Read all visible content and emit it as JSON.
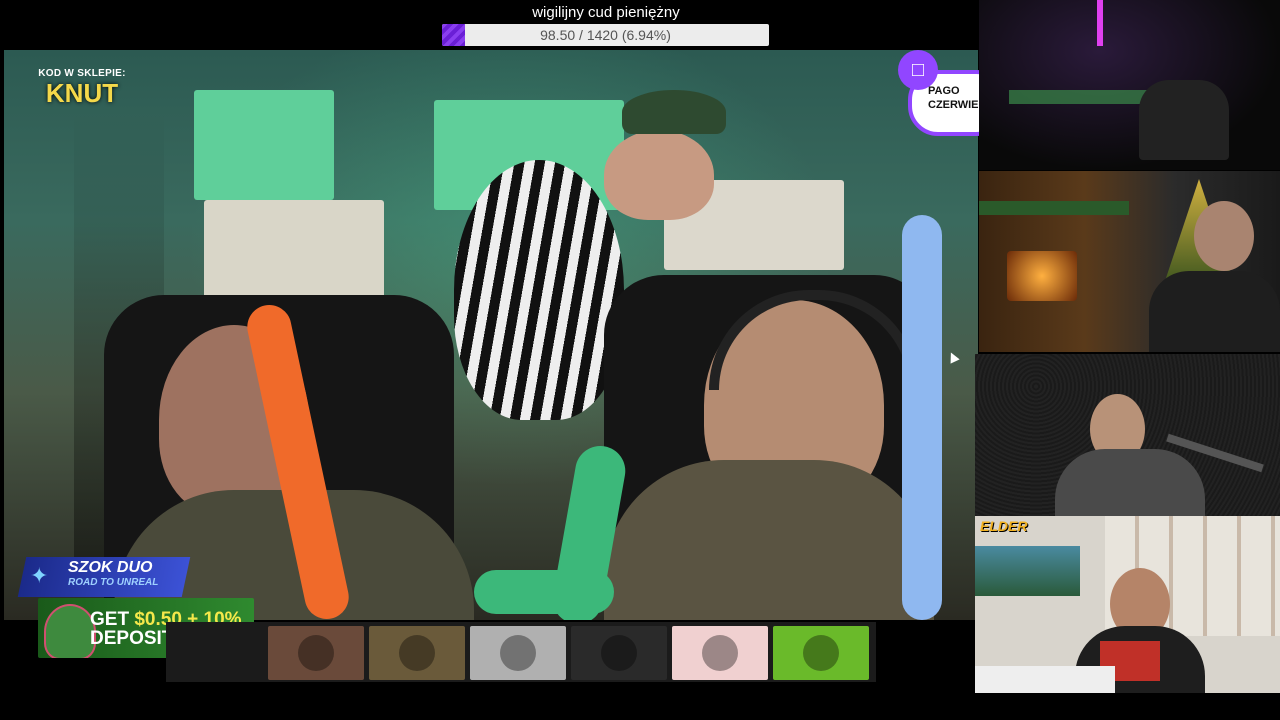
{
  "goal": {
    "title": "wigilijny cud pieniężny",
    "progress_text": "98.50 / 1420 (6.94%)",
    "current": 98.5,
    "target": 1420,
    "percent": 6.94
  },
  "overlay": {
    "shop_code_label": "KOD W SKLEPIE:",
    "shop_code": "KNUT",
    "twitch_label_1": "PAGO",
    "twitch_label_2": "CZERWIEC"
  },
  "promo": {
    "badge_title": "SZOK DUO",
    "badge_subtitle": "ROAD TO UNREAL",
    "bonus_line1_prefix": "GET ",
    "bonus_amount": "$0.50 + 10%",
    "bonus_line2": "DEPOSIT BONUS"
  },
  "cams": {
    "cam4_logo": "ELDER"
  },
  "emotes": [
    {
      "icon": "monkey-face-icon",
      "bg": "#6a4a3a"
    },
    {
      "icon": "character-icon",
      "bg": "#6a5a3a"
    },
    {
      "icon": "car-icon",
      "bg": "#b0b0b0"
    },
    {
      "icon": "man-face-icon",
      "bg": "#2a2a2a"
    },
    {
      "icon": "logo-face-icon",
      "bg": "#f0d0d0"
    },
    {
      "icon": "pepe-frog-icon",
      "bg": "#6aba2a"
    }
  ],
  "colors": {
    "twitch_purple": "#9146ff",
    "goal_fill": "#7a30e8"
  }
}
